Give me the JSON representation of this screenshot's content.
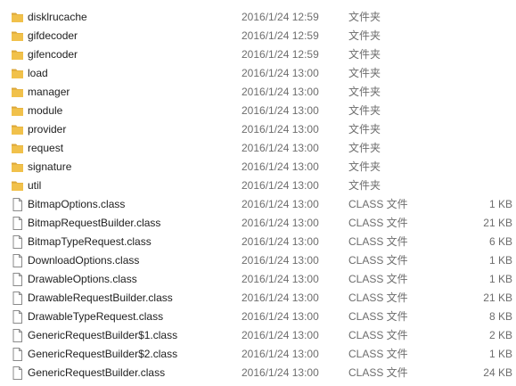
{
  "colors": {
    "folder": "#f1c14b",
    "folder_dark": "#dca73a",
    "file_border": "#8a8a8a",
    "text": "#1e1e1e",
    "secondary_text": "#6d6d6d"
  },
  "rows": [
    {
      "icon": "folder-icon",
      "name": "disklrucache",
      "date": "2016/1/24 12:59",
      "type": "文件夹",
      "size": ""
    },
    {
      "icon": "folder-icon",
      "name": "gifdecoder",
      "date": "2016/1/24 12:59",
      "type": "文件夹",
      "size": ""
    },
    {
      "icon": "folder-icon",
      "name": "gifencoder",
      "date": "2016/1/24 12:59",
      "type": "文件夹",
      "size": ""
    },
    {
      "icon": "folder-icon",
      "name": "load",
      "date": "2016/1/24 13:00",
      "type": "文件夹",
      "size": ""
    },
    {
      "icon": "folder-icon",
      "name": "manager",
      "date": "2016/1/24 13:00",
      "type": "文件夹",
      "size": ""
    },
    {
      "icon": "folder-icon",
      "name": "module",
      "date": "2016/1/24 13:00",
      "type": "文件夹",
      "size": ""
    },
    {
      "icon": "folder-icon",
      "name": "provider",
      "date": "2016/1/24 13:00",
      "type": "文件夹",
      "size": ""
    },
    {
      "icon": "folder-icon",
      "name": "request",
      "date": "2016/1/24 13:00",
      "type": "文件夹",
      "size": ""
    },
    {
      "icon": "folder-icon",
      "name": "signature",
      "date": "2016/1/24 13:00",
      "type": "文件夹",
      "size": ""
    },
    {
      "icon": "folder-icon",
      "name": "util",
      "date": "2016/1/24 13:00",
      "type": "文件夹",
      "size": ""
    },
    {
      "icon": "file-icon",
      "name": "BitmapOptions.class",
      "date": "2016/1/24 13:00",
      "type": "CLASS 文件",
      "size": "1 KB"
    },
    {
      "icon": "file-icon",
      "name": "BitmapRequestBuilder.class",
      "date": "2016/1/24 13:00",
      "type": "CLASS 文件",
      "size": "21 KB"
    },
    {
      "icon": "file-icon",
      "name": "BitmapTypeRequest.class",
      "date": "2016/1/24 13:00",
      "type": "CLASS 文件",
      "size": "6 KB"
    },
    {
      "icon": "file-icon",
      "name": "DownloadOptions.class",
      "date": "2016/1/24 13:00",
      "type": "CLASS 文件",
      "size": "1 KB"
    },
    {
      "icon": "file-icon",
      "name": "DrawableOptions.class",
      "date": "2016/1/24 13:00",
      "type": "CLASS 文件",
      "size": "1 KB"
    },
    {
      "icon": "file-icon",
      "name": "DrawableRequestBuilder.class",
      "date": "2016/1/24 13:00",
      "type": "CLASS 文件",
      "size": "21 KB"
    },
    {
      "icon": "file-icon",
      "name": "DrawableTypeRequest.class",
      "date": "2016/1/24 13:00",
      "type": "CLASS 文件",
      "size": "8 KB"
    },
    {
      "icon": "file-icon",
      "name": "GenericRequestBuilder$1.class",
      "date": "2016/1/24 13:00",
      "type": "CLASS 文件",
      "size": "2 KB"
    },
    {
      "icon": "file-icon",
      "name": "GenericRequestBuilder$2.class",
      "date": "2016/1/24 13:00",
      "type": "CLASS 文件",
      "size": "1 KB"
    },
    {
      "icon": "file-icon",
      "name": "GenericRequestBuilder.class",
      "date": "2016/1/24 13:00",
      "type": "CLASS 文件",
      "size": "24 KB"
    }
  ]
}
